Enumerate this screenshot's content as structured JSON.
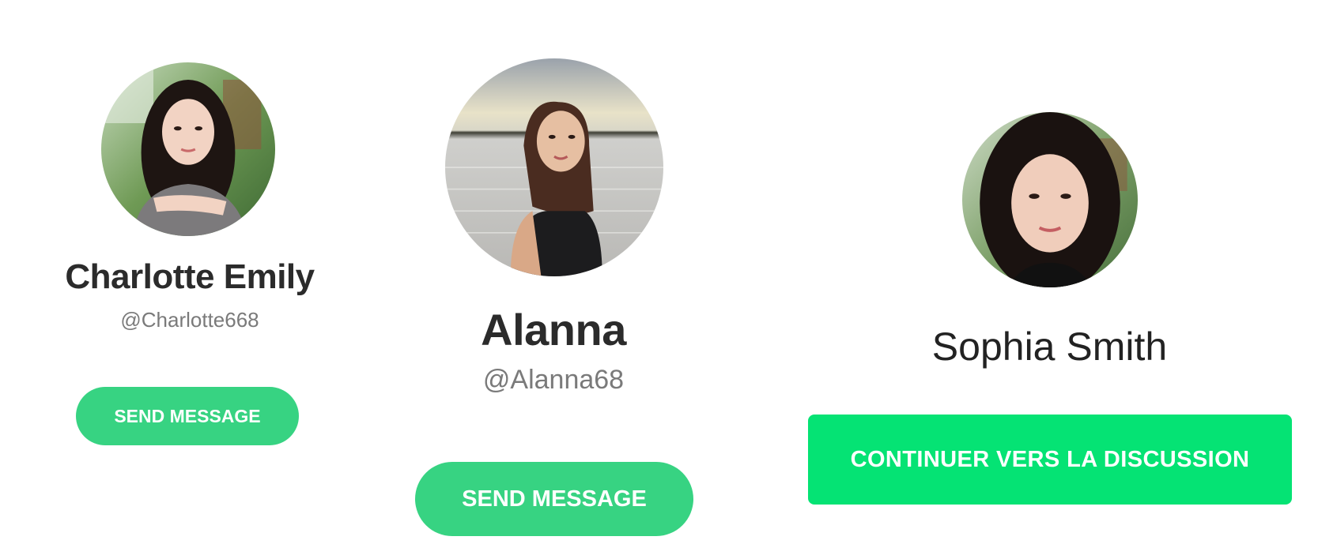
{
  "colors": {
    "primary_green": "#37d382",
    "bright_green": "#05e374",
    "name_text": "#2b2b2b",
    "handle_text": "#7a7a7a"
  },
  "profiles": [
    {
      "name": "Charlotte Emily",
      "handle": "@Charlotte668",
      "button_label": "SEND MESSAGE",
      "avatar_icon": "profile-photo"
    },
    {
      "name": "Alanna",
      "handle": "@Alanna68",
      "button_label": "SEND MESSAGE",
      "avatar_icon": "profile-photo"
    },
    {
      "name": "Sophia Smith",
      "button_label": "CONTINUER VERS LA DISCUSSION",
      "avatar_icon": "profile-photo"
    }
  ]
}
